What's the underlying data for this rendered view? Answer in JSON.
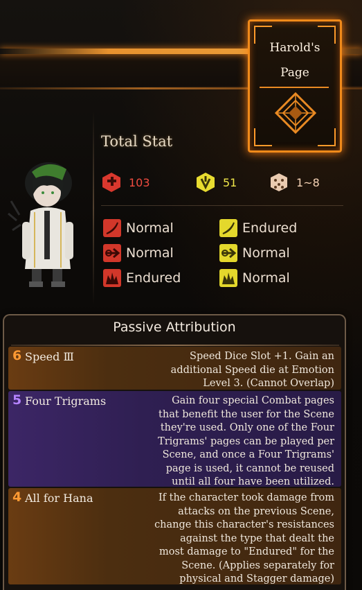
{
  "colors": {
    "accent": "#f08a1a",
    "hp": "#f04c40",
    "stagger": "#f0e64a",
    "speed": "#f6d3b6",
    "passive_orange": "#ff9a33",
    "passive_purple": "#b483ff"
  },
  "page_card": {
    "line1": "Harold's",
    "line2": "Page",
    "emblem_icon": "diamond-emblem-icon"
  },
  "total_stat": {
    "label": "Total Stat",
    "hp": {
      "icon": "health-icon",
      "value": "103"
    },
    "stagger": {
      "icon": "stagger-resist-icon",
      "value": "51"
    },
    "speed": {
      "icon": "speed-dice-icon",
      "value": "1~8"
    }
  },
  "resistances": {
    "physical": [
      {
        "icon": "slash-icon",
        "value": "Normal"
      },
      {
        "icon": "pierce-icon",
        "value": "Normal"
      },
      {
        "icon": "blunt-icon",
        "value": "Endured"
      }
    ],
    "stagger": [
      {
        "icon": "slash-icon",
        "value": "Endured"
      },
      {
        "icon": "pierce-icon",
        "value": "Normal"
      },
      {
        "icon": "blunt-icon",
        "value": "Normal"
      }
    ]
  },
  "passive": {
    "title": "Passive Attribution",
    "items": [
      {
        "cost": "6",
        "name": "Speed Ⅲ",
        "desc": "Speed Dice Slot +1. Gain an additional Speed die at Emotion Level 3. (Cannot Overlap)"
      },
      {
        "cost": "5",
        "name": "Four Trigrams",
        "desc": "Gain four special Combat pages that benefit the user for the Scene they're used. Only one of the Four Trigrams' pages can be played per Scene, and once a Four Trigrams' page is used, it cannot be reused until all four have been utilized."
      },
      {
        "cost": "4",
        "name": "All for Hana",
        "desc": "If the character took damage from attacks on the previous Scene, change this character's resistances against the type that dealt the most damage to \"Endured\" for the Scene. (Applies separately for physical and Stagger damage)"
      }
    ]
  }
}
